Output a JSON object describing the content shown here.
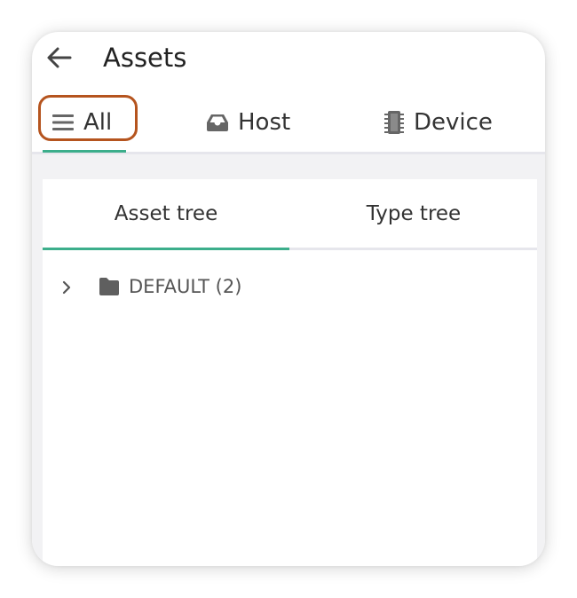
{
  "header": {
    "title": "Assets",
    "back_icon": "arrow-left-icon"
  },
  "top_tabs": [
    {
      "label": "All",
      "icon": "menu-lines-icon",
      "selected": true
    },
    {
      "label": "Host",
      "icon": "inbox-tray-icon",
      "selected": false
    },
    {
      "label": "Device",
      "icon": "chip-icon",
      "selected": false
    }
  ],
  "sub_tabs": [
    {
      "label": "Asset tree",
      "selected": true
    },
    {
      "label": "Type tree",
      "selected": false
    }
  ],
  "tree": {
    "nodes": [
      {
        "label": "DEFAULT (2)",
        "icon": "folder-icon",
        "expanded": false
      }
    ]
  },
  "colors": {
    "accent": "#3cae8b",
    "highlight": "#b5541e",
    "background": "#f2f2f4"
  }
}
